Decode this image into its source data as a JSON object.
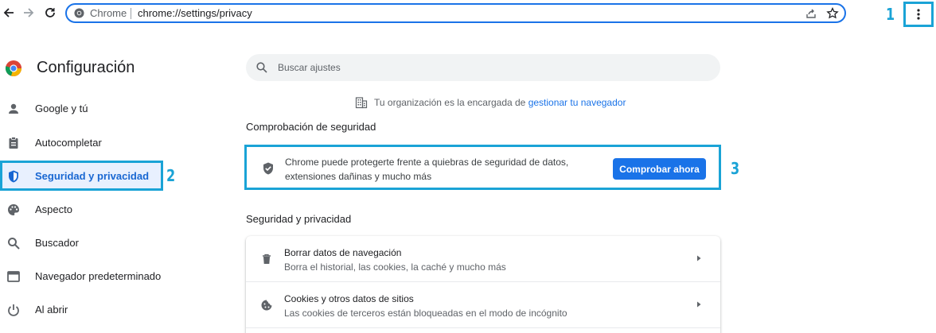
{
  "toolbar": {
    "site_name": "Chrome",
    "url": "chrome://settings/privacy"
  },
  "annotations": {
    "menu": "1",
    "sidebar": "2",
    "check": "3"
  },
  "page_title": "Configuración",
  "sidebar": {
    "items": [
      {
        "label": "Google y tú",
        "icon": "person-icon"
      },
      {
        "label": "Autocompletar",
        "icon": "clipboard-icon"
      },
      {
        "label": "Seguridad y privacidad",
        "icon": "shield-icon",
        "active": true
      },
      {
        "label": "Aspecto",
        "icon": "palette-icon"
      },
      {
        "label": "Buscador",
        "icon": "search-icon"
      },
      {
        "label": "Navegador predeterminado",
        "icon": "browser-window-icon"
      },
      {
        "label": "Al abrir",
        "icon": "power-icon"
      }
    ]
  },
  "search": {
    "placeholder": "Buscar ajustes"
  },
  "managed": {
    "text": "Tu organización es la encargada de ",
    "link": "gestionar tu navegador"
  },
  "safety_check": {
    "heading": "Comprobación de seguridad",
    "description": "Chrome puede protegerte frente a quiebras de seguridad de datos, extensiones dañinas y mucho más",
    "button": "Comprobar ahora"
  },
  "privacy": {
    "heading": "Seguridad y privacidad",
    "rows": [
      {
        "title": "Borrar datos de navegación",
        "subtitle": "Borra el historial, las cookies, la caché y mucho más",
        "icon": "trash-icon"
      },
      {
        "title": "Cookies y otros datos de sitios",
        "subtitle": "Las cookies de terceros están bloqueadas en el modo de incógnito",
        "icon": "cookie-icon"
      }
    ]
  },
  "colors": {
    "accent": "#1a73e8",
    "annotation": "#1aa3d6",
    "active_bg": "#e8f0fe"
  }
}
